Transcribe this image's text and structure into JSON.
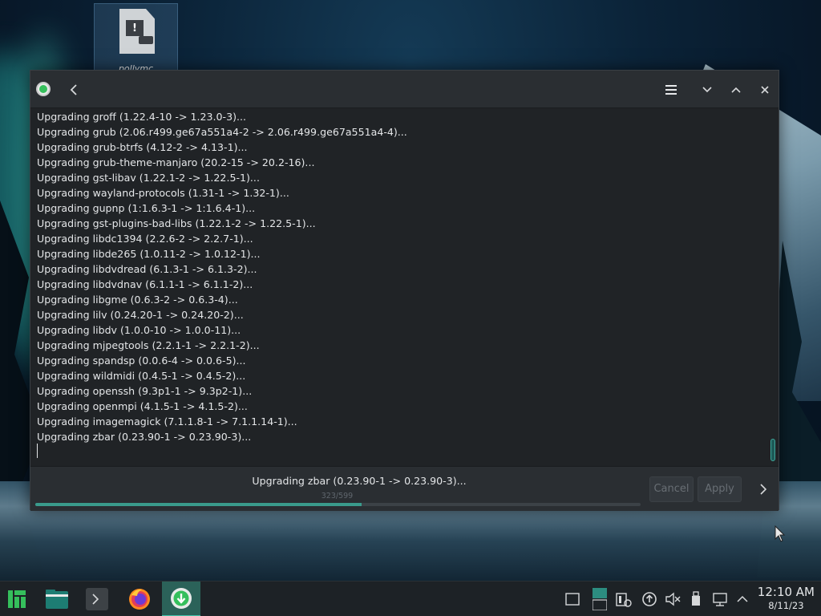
{
  "desktop": {
    "icon_label": "pollymc"
  },
  "window": {
    "console_lines": [
      "Upgrading groff (1.22.4-10 -> 1.23.0-3)...",
      "Upgrading grub (2.06.r499.ge67a551a4-2 -> 2.06.r499.ge67a551a4-4)...",
      "Upgrading grub-btrfs (4.12-2 -> 4.13-1)...",
      "Upgrading grub-theme-manjaro (20.2-15 -> 20.2-16)...",
      "Upgrading gst-libav (1.22.1-2 -> 1.22.5-1)...",
      "Upgrading wayland-protocols (1.31-1 -> 1.32-1)...",
      "Upgrading gupnp (1:1.6.3-1 -> 1:1.6.4-1)...",
      "Upgrading gst-plugins-bad-libs (1.22.1-2 -> 1.22.5-1)...",
      "Upgrading libdc1394 (2.2.6-2 -> 2.2.7-1)...",
      "Upgrading libde265 (1.0.11-2 -> 1.0.12-1)...",
      "Upgrading libdvdread (6.1.3-1 -> 6.1.3-2)...",
      "Upgrading libdvdnav (6.1.1-1 -> 6.1.1-2)...",
      "Upgrading libgme (0.6.3-2 -> 0.6.3-4)...",
      "Upgrading lilv (0.24.20-1 -> 0.24.20-2)...",
      "Upgrading libdv (1.0.0-10 -> 1.0.0-11)...",
      "Upgrading mjpegtools (2.2.1-1 -> 2.2.1-2)...",
      "Upgrading spandsp (0.0.6-4 -> 0.0.6-5)...",
      "Upgrading wildmidi (0.4.5-1 -> 0.4.5-2)...",
      "Upgrading openssh (9.3p1-1 -> 9.3p2-1)...",
      "Upgrading openmpi (4.1.5-1 -> 4.1.5-2)...",
      "Upgrading imagemagick (7.1.1.8-1 -> 7.1.1.14-1)...",
      "Upgrading zbar (0.23.90-1 -> 0.23.90-3)..."
    ],
    "status_text": "Upgrading zbar (0.23.90-1 -> 0.23.90-3)...",
    "progress": {
      "label": "323/599",
      "current": 323,
      "total": 599
    },
    "cancel_label": "Cancel",
    "apply_label": "Apply",
    "accent_color": "#3a9b8c"
  },
  "taskbar": {
    "time": "12:10 AM",
    "date": "8/11/23",
    "active_color": "#2b6259"
  }
}
